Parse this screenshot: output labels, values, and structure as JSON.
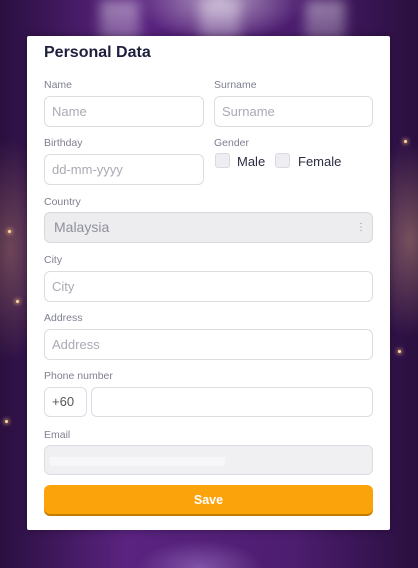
{
  "form": {
    "title": "Personal Data",
    "name": {
      "label": "Name",
      "placeholder": "Name"
    },
    "surname": {
      "label": "Surname",
      "placeholder": "Surname"
    },
    "birthday": {
      "label": "Birthday",
      "placeholder": "dd-mm-yyyy"
    },
    "gender": {
      "label": "Gender",
      "options": [
        "Male",
        "Female"
      ]
    },
    "country": {
      "label": "Country",
      "value": "Malaysia"
    },
    "city": {
      "label": "City",
      "placeholder": "City"
    },
    "address": {
      "label": "Address",
      "placeholder": "Address"
    },
    "phone": {
      "label": "Phone number",
      "prefix": "+60",
      "value": ""
    },
    "email": {
      "label": "Email"
    },
    "save_label": "Save"
  },
  "colors": {
    "accent": "#fba30a",
    "title": "#1e1f3b",
    "background": "#4d1d70"
  },
  "icons": {
    "country_select": "vertical-dots-icon"
  }
}
